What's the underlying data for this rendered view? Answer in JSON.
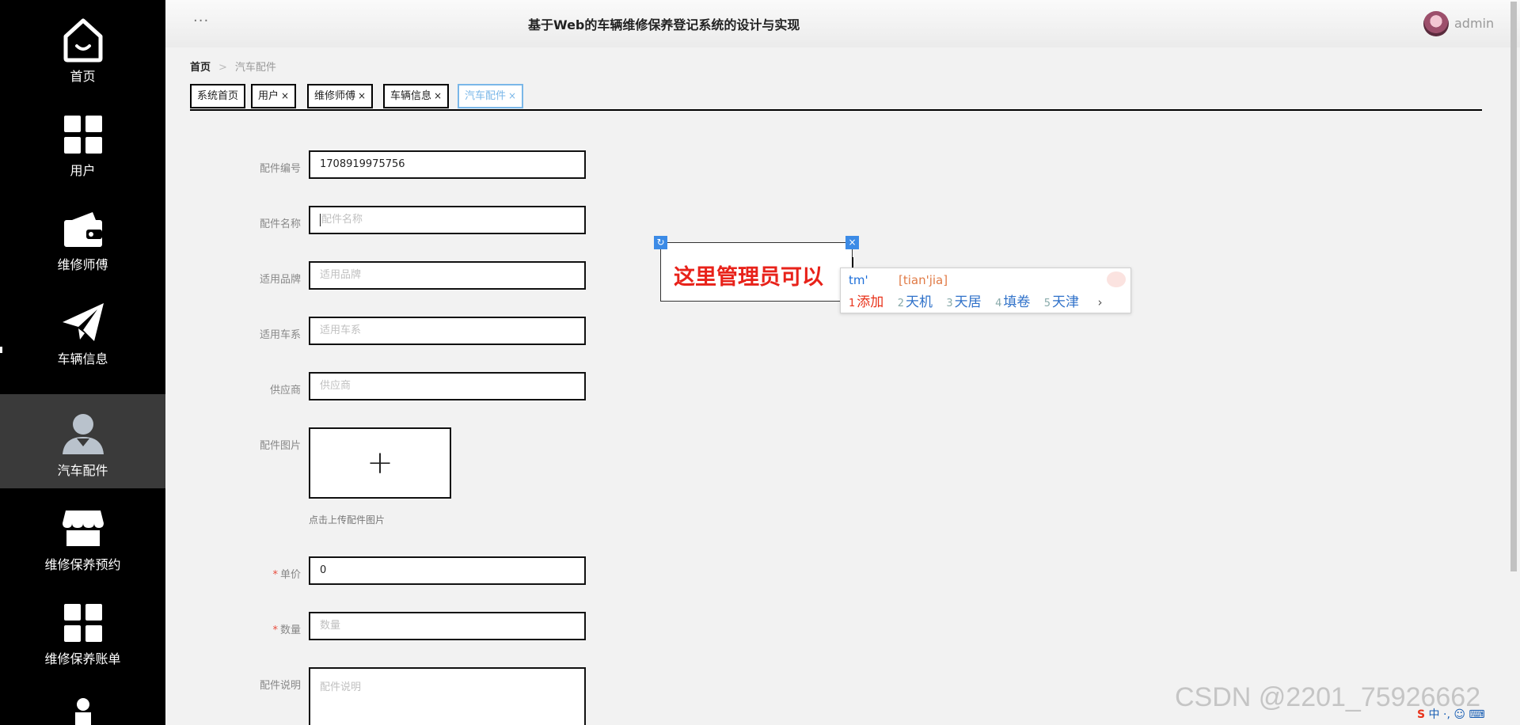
{
  "app": {
    "title": "基于Web的车辆维修保养登记系统的设计与实现",
    "user": "admin",
    "menu_dots": "···"
  },
  "sidebar": {
    "items": [
      {
        "label": "首页",
        "icon": "home-icon"
      },
      {
        "label": "用户",
        "icon": "grid-icon"
      },
      {
        "label": "维修师傅",
        "icon": "wallet-icon"
      },
      {
        "label": "车辆信息",
        "icon": "paper-plane-icon"
      },
      {
        "label": "汽车配件",
        "icon": "user-icon",
        "active": true
      },
      {
        "label": "维修保养预约",
        "icon": "store-icon"
      },
      {
        "label": "维修保养账单",
        "icon": "grid-icon"
      }
    ]
  },
  "breadcrumb": {
    "home": "首页",
    "separator": ">",
    "current": "汽车配件"
  },
  "tabs": [
    {
      "label": "系统首页",
      "closable": false
    },
    {
      "label": "用户",
      "closable": true
    },
    {
      "label": "维修师傅",
      "closable": true
    },
    {
      "label": "车辆信息",
      "closable": true
    },
    {
      "label": "汽车配件",
      "closable": true,
      "active": true
    }
  ],
  "tab_close_glyph": "×",
  "form": {
    "part_no": {
      "label": "配件编号",
      "value": "1708919975756"
    },
    "part_name": {
      "label": "配件名称",
      "placeholder": "配件名称"
    },
    "brand": {
      "label": "适用品牌",
      "placeholder": "适用品牌"
    },
    "series": {
      "label": "适用车系",
      "placeholder": "适用车系"
    },
    "supplier": {
      "label": "供应商",
      "placeholder": "供应商"
    },
    "image": {
      "label": "配件图片",
      "plus": "+",
      "hint": "点击上传配件图片"
    },
    "price": {
      "label": "单价",
      "required": "*",
      "value": "0"
    },
    "quantity": {
      "label": "数量",
      "required": "*",
      "placeholder": "数量"
    },
    "description": {
      "label": "配件说明",
      "placeholder": "配件说明"
    }
  },
  "annotation": {
    "text": "这里管理员可以",
    "rotate_glyph": "↻",
    "close_glyph": "×",
    "color": "#e8221a"
  },
  "ime": {
    "input": "tm'",
    "pinyin": "[tian'jia]",
    "candidates": [
      {
        "n": "1",
        "text": "添加"
      },
      {
        "n": "2",
        "text": "天机"
      },
      {
        "n": "3",
        "text": "天居"
      },
      {
        "n": "4",
        "text": "填卷"
      },
      {
        "n": "5",
        "text": "天津"
      }
    ],
    "next_glyph": "›"
  },
  "watermark": "CSDN @2201_75926662",
  "tray": {
    "logo": "S",
    "text": "中 ·, ☺ ⌨"
  }
}
